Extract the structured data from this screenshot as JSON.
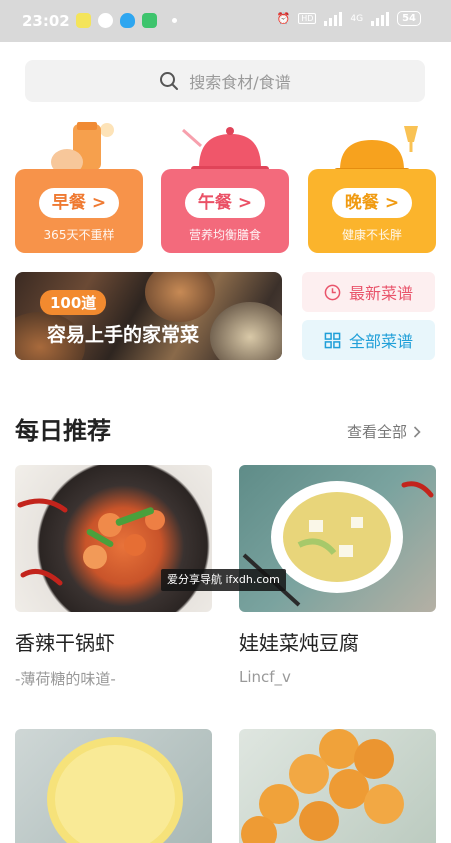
{
  "status_bar": {
    "time": "23:02",
    "battery": "54",
    "network": "4G"
  },
  "search": {
    "placeholder": "搜索食材/食谱",
    "icon": "search-icon"
  },
  "meal_categories": [
    {
      "label": "早餐 >",
      "subtitle": "365天不重样",
      "color": "#f7934a",
      "label_color": "#ef7a32"
    },
    {
      "label": "午餐 >",
      "subtitle": "营养均衡膳食",
      "color": "#f36a7c",
      "label_color": "#ea5166"
    },
    {
      "label": "晚餐 >",
      "subtitle": "健康不长胖",
      "color": "#fbb42c",
      "label_color": "#f09b12"
    }
  ],
  "banner": {
    "tag": "100道",
    "title": "容易上手的家常菜"
  },
  "side_buttons": {
    "latest": {
      "label": "最新菜谱",
      "icon": "clock-icon"
    },
    "all": {
      "label": "全部菜谱",
      "icon": "grid-icon"
    }
  },
  "daily": {
    "title": "每日推荐",
    "see_all": "查看全部"
  },
  "recipes": [
    {
      "title": "香辣干锅虾",
      "author": "-薄荷糖的味道-"
    },
    {
      "title": "娃娃菜炖豆腐",
      "author": "Lincf_v"
    },
    {
      "title": "",
      "author": ""
    },
    {
      "title": "",
      "author": ""
    }
  ],
  "watermark": "爱分享导航 ifxdh.com"
}
